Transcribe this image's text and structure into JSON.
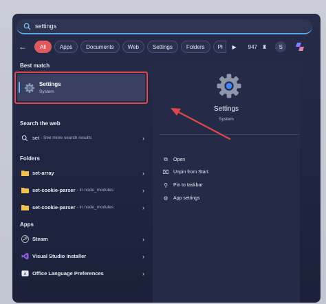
{
  "search": {
    "value": "settings"
  },
  "filters": {
    "back": "←",
    "chips": [
      "All",
      "Apps",
      "Documents",
      "Web",
      "Settings",
      "Folders",
      "Pł"
    ],
    "play": "▶",
    "count": "947",
    "avatar": "S"
  },
  "left": {
    "best_match_title": "Best match",
    "best": {
      "name": "Settings",
      "sub": "System"
    },
    "web_title": "Search the web",
    "web": {
      "term": "set",
      "suffix": "- See more search results"
    },
    "folders_title": "Folders",
    "folders": [
      {
        "name": "set-array",
        "suffix": ""
      },
      {
        "name": "set-cookie-parser",
        "suffix": "- in node_modules"
      },
      {
        "name": "set-cookie-parser",
        "suffix": "- in node_modules"
      }
    ],
    "apps_title": "Apps",
    "apps": [
      {
        "name": "Steam",
        "icon": "steam-icon"
      },
      {
        "name": "Visual Studio Installer",
        "icon": "visual-studio-icon"
      },
      {
        "name": "Office Language Preferences",
        "icon": "office-icon"
      }
    ]
  },
  "preview": {
    "title": "Settings",
    "sub": "System",
    "actions": [
      "Open",
      "Unpin from Start",
      "Pin to taskbar",
      "App settings"
    ]
  },
  "colors": {
    "accent": "#e0595f",
    "highlight": "#e0474c",
    "panel": "#252b47"
  }
}
